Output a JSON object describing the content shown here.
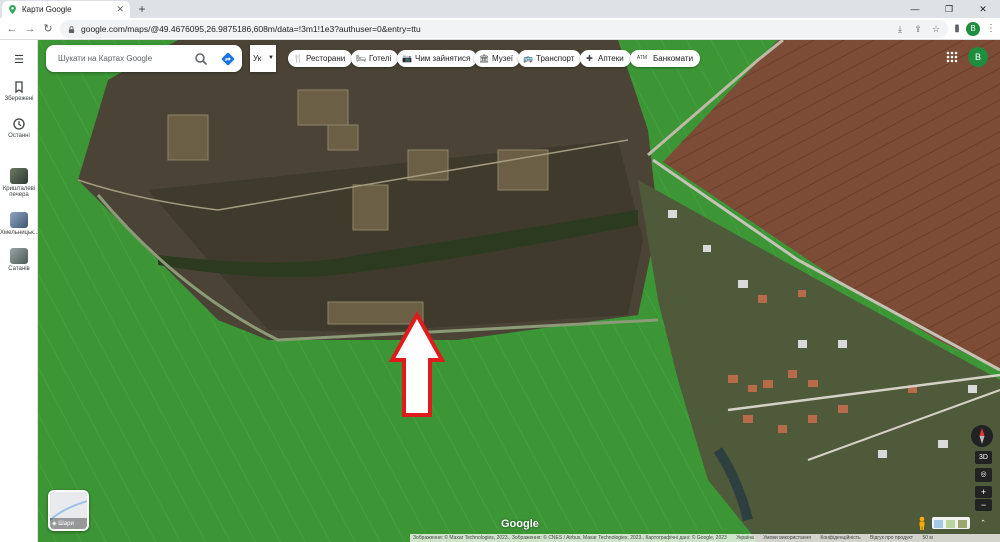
{
  "browser": {
    "tab_title": "Карти Google",
    "tab_close": "✕",
    "new_tab": "+",
    "url": "google.com/maps/@49.4676095,26.9875186,608m/data=!3m1!1e3?authuser=0&entry=ttu",
    "window_controls": [
      "—",
      "❐",
      "✕"
    ],
    "profile_initial": "B"
  },
  "rail": {
    "saved_label": "Збережені",
    "recent_label": "Останні",
    "recent_places": [
      {
        "label": "Кришталеві печера"
      },
      {
        "label": "Хмельницьк..."
      },
      {
        "label": "Сатанів"
      }
    ]
  },
  "search": {
    "placeholder": "Шукати на Картах Google",
    "language": "Ук"
  },
  "chips": [
    {
      "label": "Ресторани",
      "icon": "restaurant-icon",
      "glyph": "🍴"
    },
    {
      "label": "Готелі",
      "icon": "hotel-icon",
      "glyph": "🛏"
    },
    {
      "label": "Чим зайнятися",
      "icon": "things-to-do-icon",
      "glyph": "📷"
    },
    {
      "label": "Музеї",
      "icon": "museum-icon",
      "glyph": "🏛"
    },
    {
      "label": "Транспорт",
      "icon": "transit-icon",
      "glyph": "🚌"
    },
    {
      "label": "Аптеки",
      "icon": "pharmacy-icon",
      "glyph": "✚"
    },
    {
      "label": "Банкомати",
      "icon": "atm-icon",
      "glyph": "ATM"
    }
  ],
  "map": {
    "account_initial": "B",
    "layers_label": "Шари",
    "logo": "Google",
    "control_3d": "3D",
    "zoom_in": "+",
    "zoom_out": "−",
    "footer": [
      "Зображення: © Maxar Technologies, 2023., Зображення: © CNES / Airbus, Maxar Technologies, 2023., Картографічні дані: © Google, 2023",
      "Україна",
      "Умови використання",
      "Конфіденційність",
      "Відгук про продукт",
      "50 м"
    ],
    "colors": {
      "field_green": "#3f9a38",
      "plowed_field": "#7a4b35",
      "arrow_outline": "#e01b1b"
    }
  }
}
